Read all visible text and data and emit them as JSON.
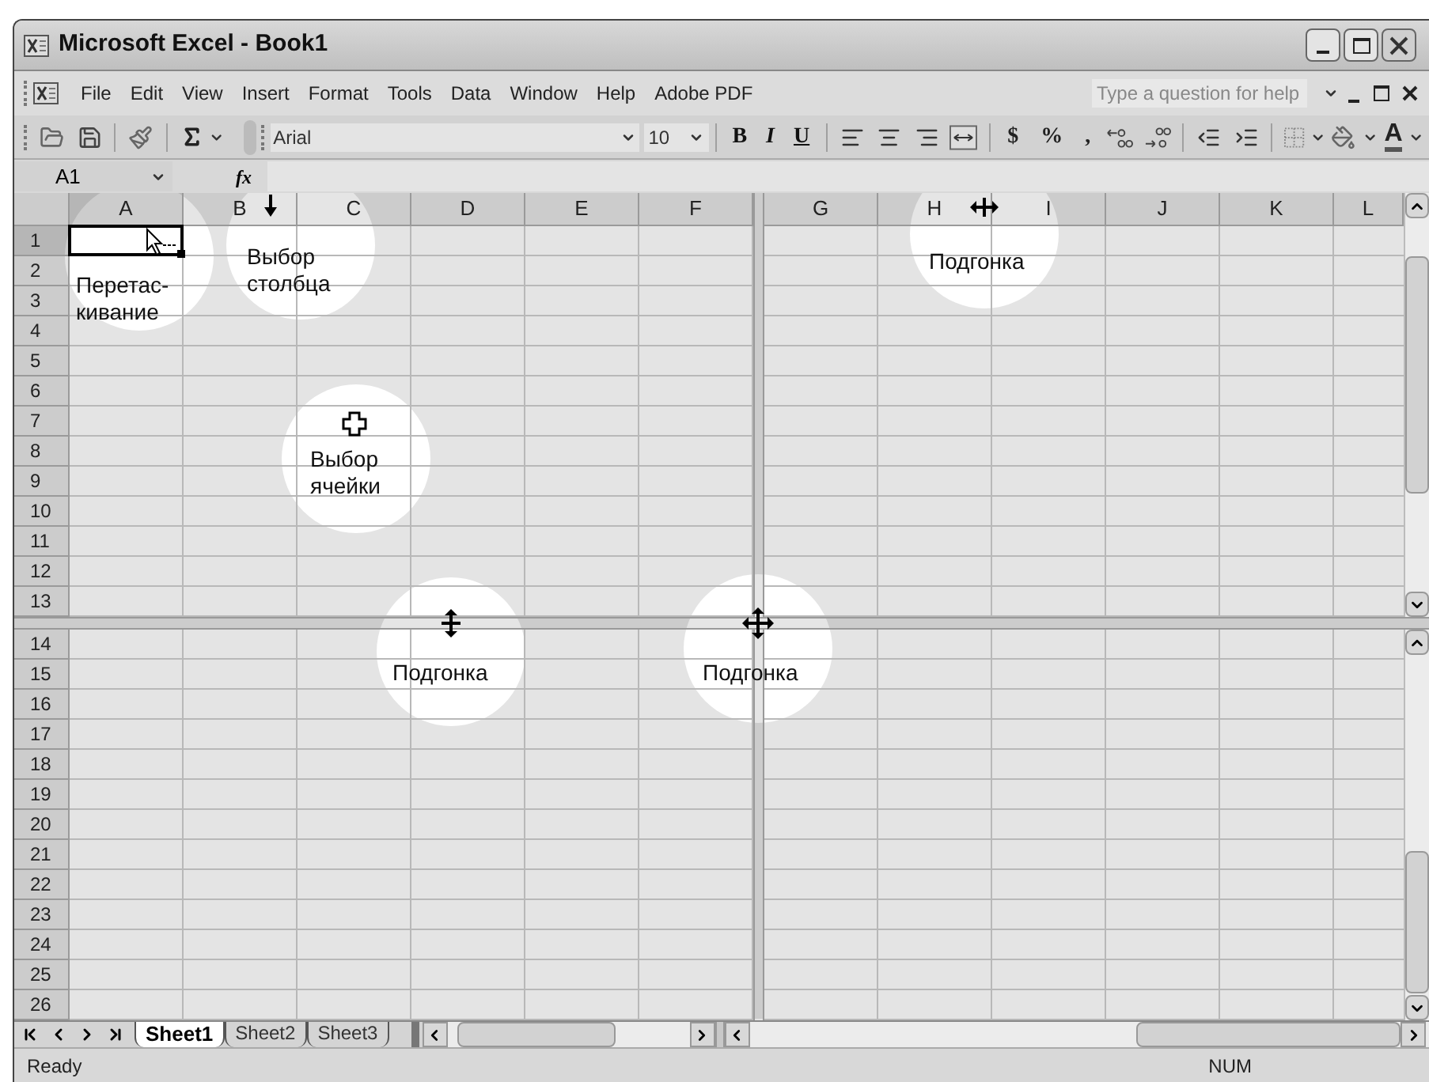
{
  "window": {
    "title": "Microsoft Excel - Book1"
  },
  "menu": [
    "File",
    "Edit",
    "View",
    "Insert",
    "Format",
    "Tools",
    "Data",
    "Window",
    "Help",
    "Adobe PDF"
  ],
  "help_box": {
    "placeholder": "Type a question for help"
  },
  "toolbar": {
    "font": "Arial",
    "font_size": "10",
    "style_buttons": [
      "B",
      "I",
      "U"
    ],
    "number_buttons": [
      "$",
      "%",
      ","
    ],
    "font_color_button": "A"
  },
  "formula_bar": {
    "name_box": "A1",
    "function_label": "fx"
  },
  "columns_left": [
    {
      "label": "A",
      "selected": true
    },
    {
      "label": "B",
      "selected": false
    },
    {
      "label": "C",
      "selected": false
    },
    {
      "label": "D",
      "selected": false
    },
    {
      "label": "E",
      "selected": false
    },
    {
      "label": "F",
      "selected": false
    }
  ],
  "columns_right": [
    {
      "label": "G",
      "selected": false
    },
    {
      "label": "H",
      "selected": false
    },
    {
      "label": "I",
      "selected": false
    },
    {
      "label": "J",
      "selected": false
    },
    {
      "label": "K",
      "selected": false
    },
    {
      "label": "L",
      "selected": false
    }
  ],
  "rows_top": [
    {
      "label": "1",
      "selected": true
    },
    {
      "label": "2",
      "selected": false
    },
    {
      "label": "3",
      "selected": false
    },
    {
      "label": "4",
      "selected": false
    },
    {
      "label": "5",
      "selected": false
    },
    {
      "label": "6",
      "selected": false
    },
    {
      "label": "7",
      "selected": false
    },
    {
      "label": "8",
      "selected": false
    },
    {
      "label": "9",
      "selected": false
    },
    {
      "label": "10",
      "selected": false
    },
    {
      "label": "11",
      "selected": false
    },
    {
      "label": "12",
      "selected": false
    },
    {
      "label": "13",
      "selected": false
    }
  ],
  "rows_bottom": [
    {
      "label": "14",
      "selected": false
    },
    {
      "label": "15",
      "selected": false
    },
    {
      "label": "16",
      "selected": false
    },
    {
      "label": "17",
      "selected": false
    },
    {
      "label": "18",
      "selected": false
    },
    {
      "label": "19",
      "selected": false
    },
    {
      "label": "20",
      "selected": false
    },
    {
      "label": "21",
      "selected": false
    },
    {
      "label": "22",
      "selected": false
    },
    {
      "label": "23",
      "selected": false
    },
    {
      "label": "24",
      "selected": false
    },
    {
      "label": "25",
      "selected": false
    },
    {
      "label": "26",
      "selected": false
    }
  ],
  "callouts": [
    {
      "kind": "drag",
      "text": "Перетас-\nкивание"
    },
    {
      "kind": "column_select",
      "text": "Выбор\nстолбца"
    },
    {
      "kind": "cell_select",
      "text": "Выбор\nячейки"
    },
    {
      "kind": "column_fit",
      "text": "Подгонка"
    },
    {
      "kind": "row_fit",
      "text": "Подгонка"
    },
    {
      "kind": "pane_fit",
      "text": "Подгонка"
    }
  ],
  "sheet_tabs": [
    {
      "label": "Sheet1",
      "selected": true
    },
    {
      "label": "Sheet2",
      "selected": false
    },
    {
      "label": "Sheet3",
      "selected": false
    }
  ],
  "status_bar": {
    "text": "Ready",
    "indicator": "NUM"
  }
}
